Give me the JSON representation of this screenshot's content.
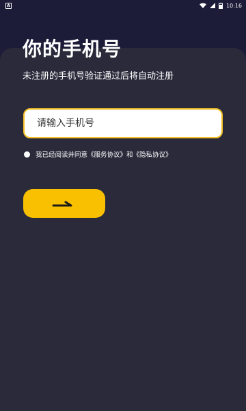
{
  "status_bar": {
    "left_icon_letter": "A",
    "icons": [
      "wifi-icon",
      "signal-icon",
      "battery-icon"
    ],
    "time": "10:16"
  },
  "login": {
    "title": "你的手机号",
    "subtitle": "未注册的手机号验证通过后将自动注册",
    "phone_placeholder": "请输入手机号",
    "agreement_prefix": "我已经阅读并同意",
    "service_agreement": "《服务协议》",
    "agreement_and": "和",
    "privacy_agreement": "《隐私协议》",
    "next_button_icon": "arrow-right-icon"
  },
  "colors": {
    "background": "#1c1b38",
    "card": "#2a2a3b",
    "accent": "#f8c000",
    "input_border": "#f5c022",
    "text": "#ffffff"
  }
}
